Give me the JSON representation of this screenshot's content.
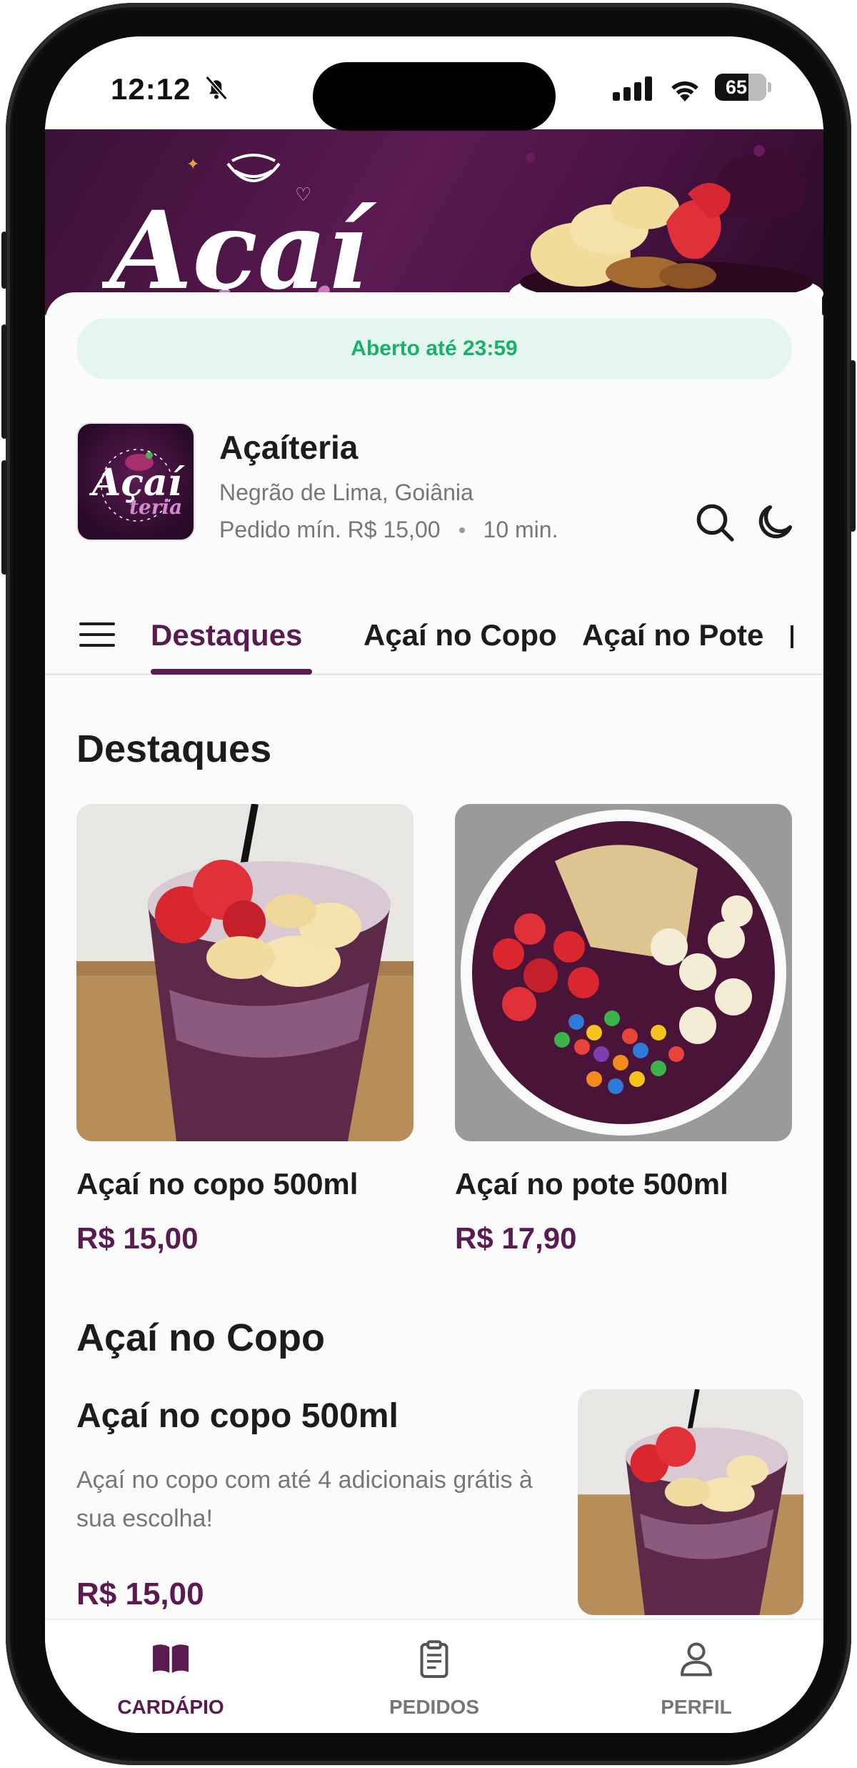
{
  "status_bar": {
    "time": "12:12",
    "battery": "65",
    "battery_level": 0.65
  },
  "banner": {
    "logo_text": "Açaí",
    "logo_subtext": "teria"
  },
  "store": {
    "open_status": "Aberto até 23:59",
    "name": "Açaíteria",
    "location": "Negrão de Lima, Goiânia",
    "min_order": "Pedido mín. R$ 15,00",
    "delivery_time": "10 min.",
    "logo_text": "Açaí",
    "logo_subtext": "teria"
  },
  "tabs": [
    {
      "label": "Destaques",
      "active": true
    },
    {
      "label": "Açaí no Copo",
      "active": false
    },
    {
      "label": "Açaí no Pote",
      "active": false
    }
  ],
  "highlights": {
    "title": "Destaques",
    "items": [
      {
        "name": "Açaí no copo 500ml",
        "price": "R$ 15,00"
      },
      {
        "name": "Açaí no pote 500ml",
        "price": "R$ 17,90"
      }
    ]
  },
  "section_copo": {
    "title": "Açaí no Copo",
    "items": [
      {
        "name": "Açaí no copo 500ml",
        "description": "Açaí no copo com até 4 adicionais grátis à sua escolha!",
        "price": "R$ 15,00"
      }
    ]
  },
  "bottom_nav": [
    {
      "label": "CARDÁPIO",
      "icon": "book-icon",
      "active": true
    },
    {
      "label": "PEDIDOS",
      "icon": "clipboard-icon",
      "active": false
    },
    {
      "label": "PERFIL",
      "icon": "user-icon",
      "active": false
    }
  ],
  "colors": {
    "brand": "#5a1b50",
    "open": "#17b26a",
    "open_bg": "#e4f6ef"
  }
}
